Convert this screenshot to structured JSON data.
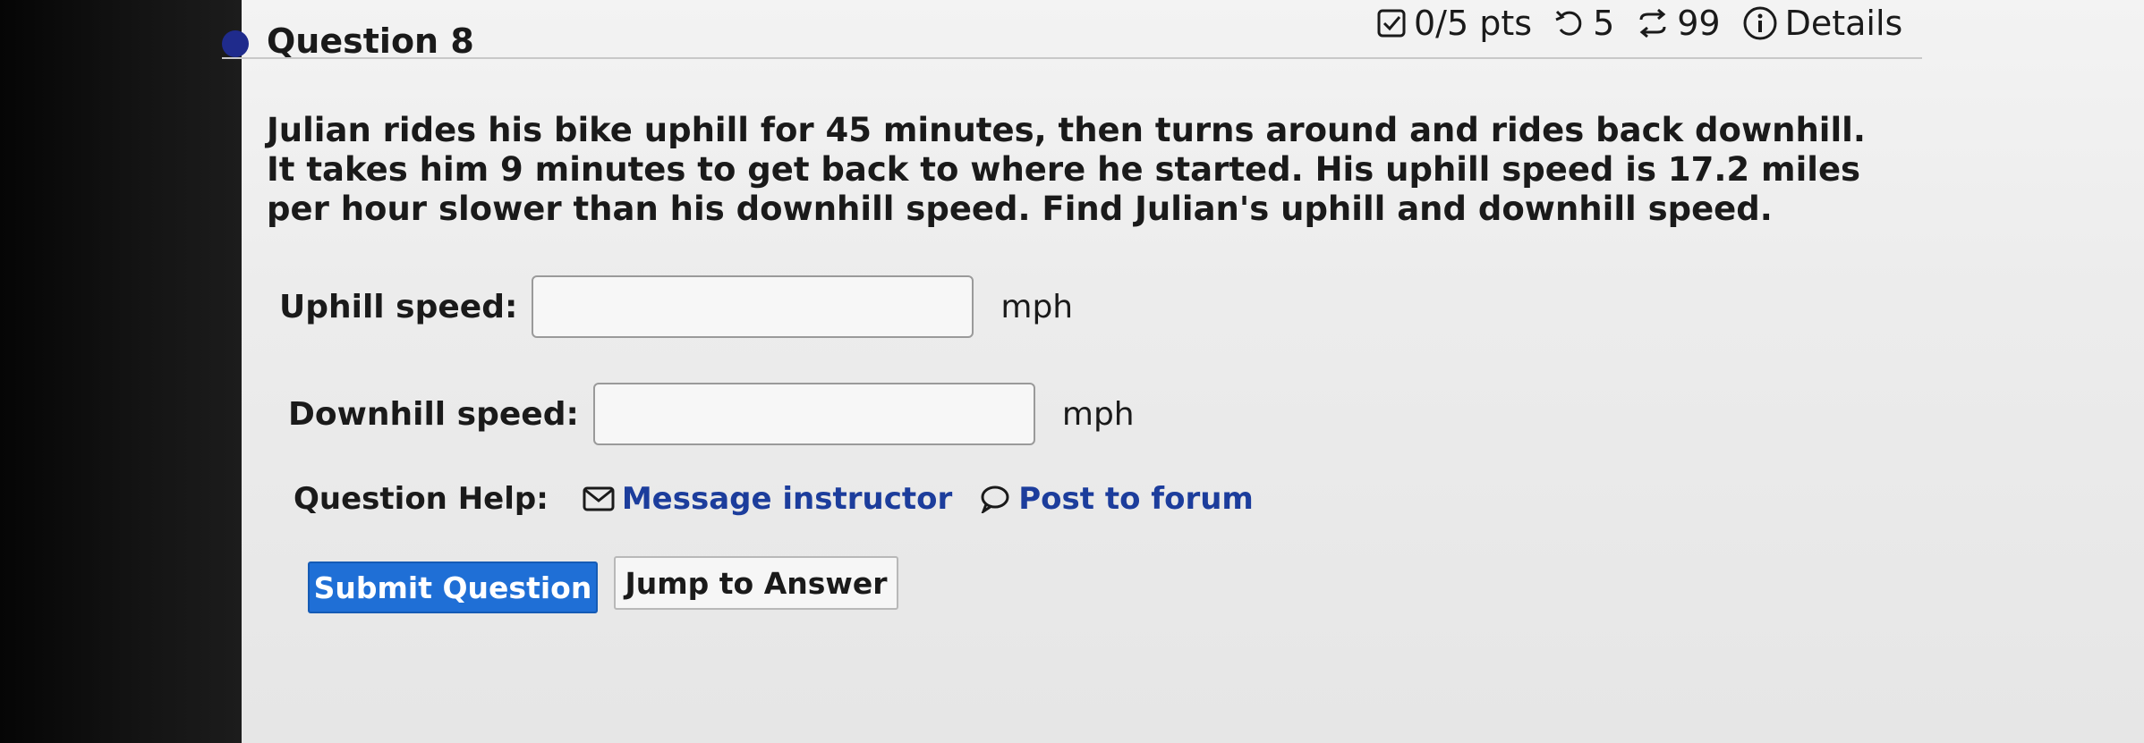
{
  "question": {
    "title": "Question 8",
    "points": "0/5 pts",
    "retries": "5",
    "attempts": "99",
    "details_label": "Details",
    "text": "Julian rides his bike uphill for 45 minutes, then turns around and rides back downhill. It takes him 9 minutes to get back to where he started. His uphill speed is 17.2 miles per hour slower than his downhill speed. Find Julian's uphill and downhill speed."
  },
  "fields": {
    "uphill": {
      "label": "Uphill speed:",
      "value": "",
      "unit": "mph"
    },
    "downhill": {
      "label": "Downhill speed:",
      "value": "",
      "unit": "mph"
    }
  },
  "help": {
    "label": "Question Help:",
    "message_instructor": "Message instructor",
    "post_to_forum": "Post to forum"
  },
  "buttons": {
    "submit": "Submit Question",
    "jump": "Jump to Answer"
  },
  "icons": {
    "status": "circle-bullet-icon",
    "points": "checkbox-icon",
    "retries": "undo-icon",
    "attempts": "repeat-icon",
    "details": "info-icon",
    "message": "envelope-icon",
    "forum": "speech-bubble-icon"
  },
  "colors": {
    "accent": "#1f6fd6",
    "link": "#1c3d9c",
    "status_dot": "#1f2b8c"
  }
}
